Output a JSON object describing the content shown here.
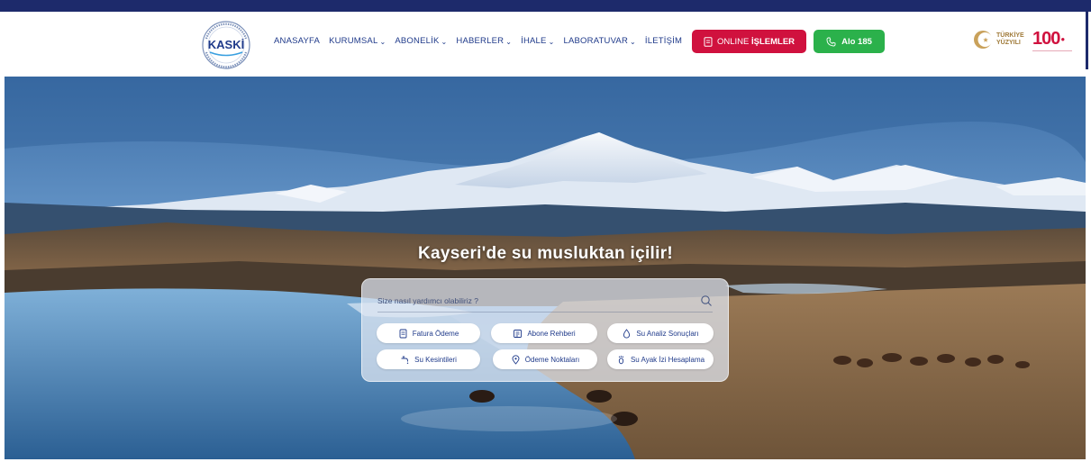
{
  "logo": {
    "text": "KASKİ",
    "ring_text": "KAYSERİ SU VE KANALİZASYON İDARESİ"
  },
  "nav": {
    "items": [
      {
        "label": "ANASAYFA",
        "has_dropdown": false
      },
      {
        "label": "KURUMSAL",
        "has_dropdown": true
      },
      {
        "label": "ABONELİK",
        "has_dropdown": true
      },
      {
        "label": "HABERLER",
        "has_dropdown": true
      },
      {
        "label": "İHALE",
        "has_dropdown": true
      },
      {
        "label": "LABORATUVAR",
        "has_dropdown": true
      },
      {
        "label": "İLETİŞİM",
        "has_dropdown": false
      }
    ]
  },
  "actions": {
    "online_prefix": "ONLINE",
    "online_bold": "İŞLEMLER",
    "alo": "Alo 185"
  },
  "brands": {
    "turkiye_line1": "TÜRKİYE",
    "turkiye_line2": "YÜZYILI",
    "hundred": "100"
  },
  "hero": {
    "headline": "Kayseri'de su musluktan içilir!",
    "search_placeholder": "Size nasıl yardımcı olabiliriz ?",
    "quick_links": [
      {
        "label": "Fatura Ödeme",
        "icon": "invoice-icon"
      },
      {
        "label": "Abone Rehberi",
        "icon": "guide-icon"
      },
      {
        "label": "Su Analiz Sonuçları",
        "icon": "water-drop-icon"
      },
      {
        "label": "Su Kesintileri",
        "icon": "faucet-icon"
      },
      {
        "label": "Ödeme Noktaları",
        "icon": "location-pin-icon"
      },
      {
        "label": "Su Ayak İzi Hesaplama",
        "icon": "footprint-icon"
      }
    ]
  },
  "colors": {
    "topbar": "#1d2a6b",
    "nav_text": "#1f3a8a",
    "online_button": "#d0113e",
    "alo_button": "#2bb14b"
  }
}
